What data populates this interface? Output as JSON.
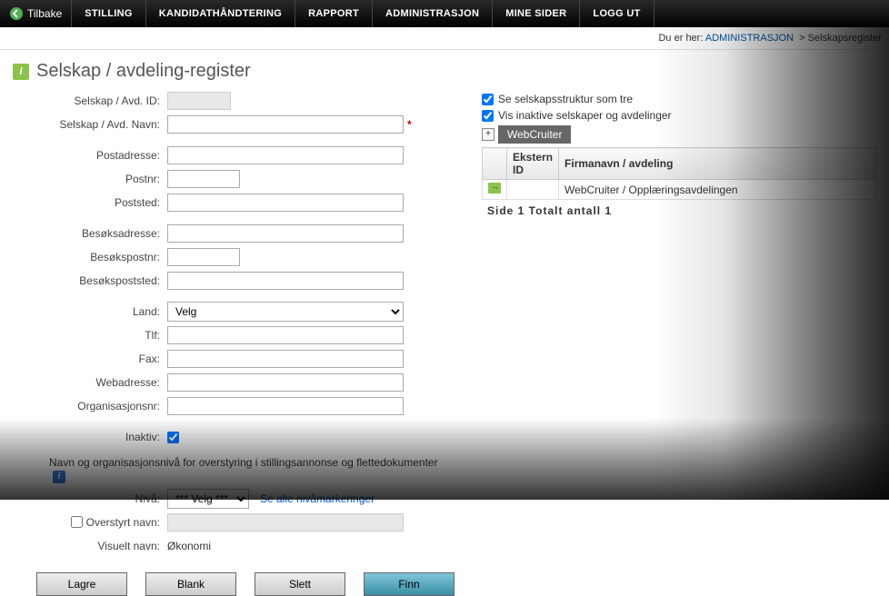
{
  "nav": {
    "back": "Tilbake",
    "items": [
      "STILLING",
      "KANDIDATHÅNDTERING",
      "RAPPORT",
      "ADMINISTRASJON",
      "MINE SIDER",
      "LOGG UT"
    ]
  },
  "breadcrumb": {
    "prefix": "Du er her:",
    "section": "ADMINISTRASJON",
    "sep": ">",
    "page": "Selskapsregister"
  },
  "title": "Selskap / avdeling-register",
  "form": {
    "labels": {
      "id": "Selskap / Avd. ID:",
      "name": "Selskap / Avd. Navn:",
      "postadresse": "Postadresse:",
      "postnr": "Postnr:",
      "poststed": "Poststed:",
      "besoksadresse": "Besøksadresse:",
      "besokspostnr": "Besøkspostnr:",
      "besokspoststed": "Besøkspoststed:",
      "land": "Land:",
      "tlf": "Tlf:",
      "fax": "Fax:",
      "webadresse": "Webadresse:",
      "orgnr": "Organisasjonsnr:",
      "inaktiv": "Inaktiv:",
      "nivaa": "Nivå:",
      "overstyrt": "Overstyrt navn:",
      "visuelt": "Visuelt navn:"
    },
    "land_option": "Velg",
    "nivaa_option": "*** Velg ***",
    "nivaa_link": "Se alle nivåmarkeringer",
    "visuelt_value": "Økonomi",
    "inaktiv_checked": true,
    "subheading": "Navn og organisasjonsnivå for overstyring i stillingsannonse og flettedokumenter"
  },
  "right": {
    "tree_checkbox": "Se selskapsstruktur som tre",
    "inactive_checkbox": "Vis inaktive selskaper og avdelinger",
    "tree_root": "WebCruiter",
    "table": {
      "headers": {
        "extern": "Ekstern ID",
        "firma": "Firmanavn / avdeling"
      },
      "rows": [
        {
          "extern": "",
          "firma": "WebCruiter / Opplæringsavdelingen"
        }
      ]
    },
    "pager": "Side  1   Totalt antall 1"
  },
  "buttons": {
    "lagre": "Lagre",
    "blank": "Blank",
    "slett": "Slett",
    "finn": "Finn"
  }
}
